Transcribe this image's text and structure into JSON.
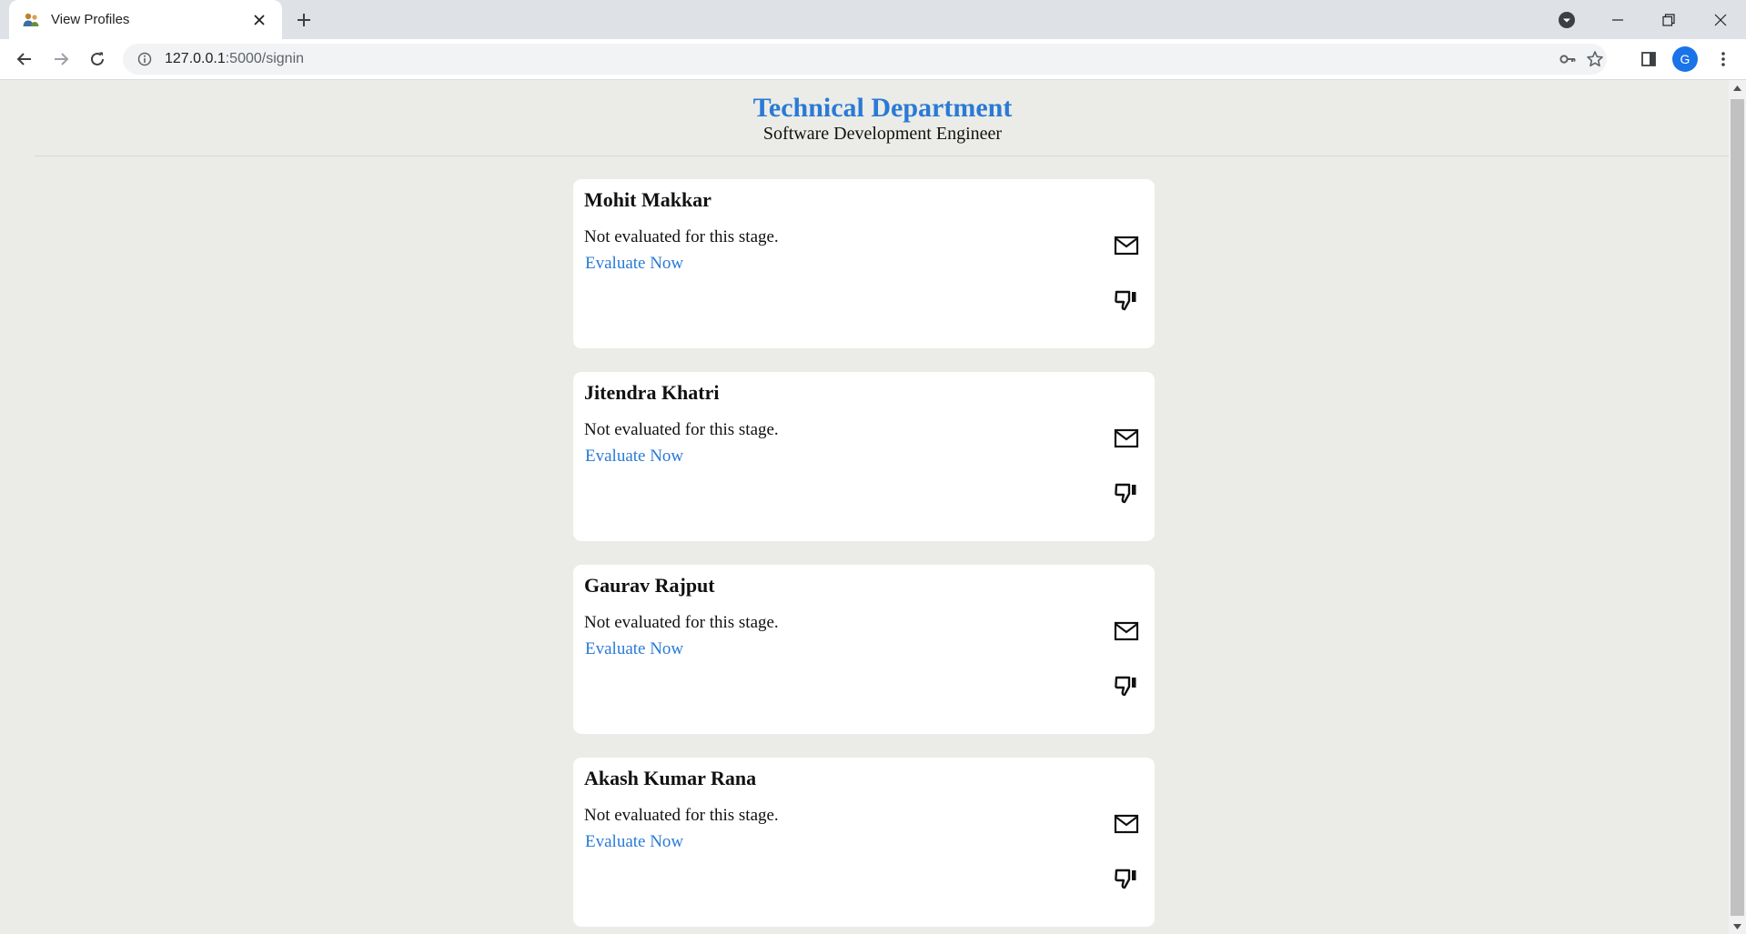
{
  "browser": {
    "tab_title": "View Profiles",
    "url_host": "127.0.0.1",
    "url_path": ":5000/signin",
    "profile_initial": "G"
  },
  "header": {
    "department": "Technical Department",
    "role": "Software Development Engineer"
  },
  "candidates": [
    {
      "name": "Mohit Makkar",
      "status": "Not evaluated for this stage.",
      "action": "Evaluate Now"
    },
    {
      "name": "Jitendra Khatri",
      "status": "Not evaluated for this stage.",
      "action": "Evaluate Now"
    },
    {
      "name": "Gaurav Rajput",
      "status": "Not evaluated for this stage.",
      "action": "Evaluate Now"
    },
    {
      "name": "Akash Kumar Rana",
      "status": "Not evaluated for this stage.",
      "action": "Evaluate Now"
    }
  ],
  "colors": {
    "accent": "#2a7ad6",
    "page_background": "#ebece7",
    "card_background": "#ffffff"
  },
  "icons": [
    "mail-icon",
    "thumbs-down-icon"
  ]
}
